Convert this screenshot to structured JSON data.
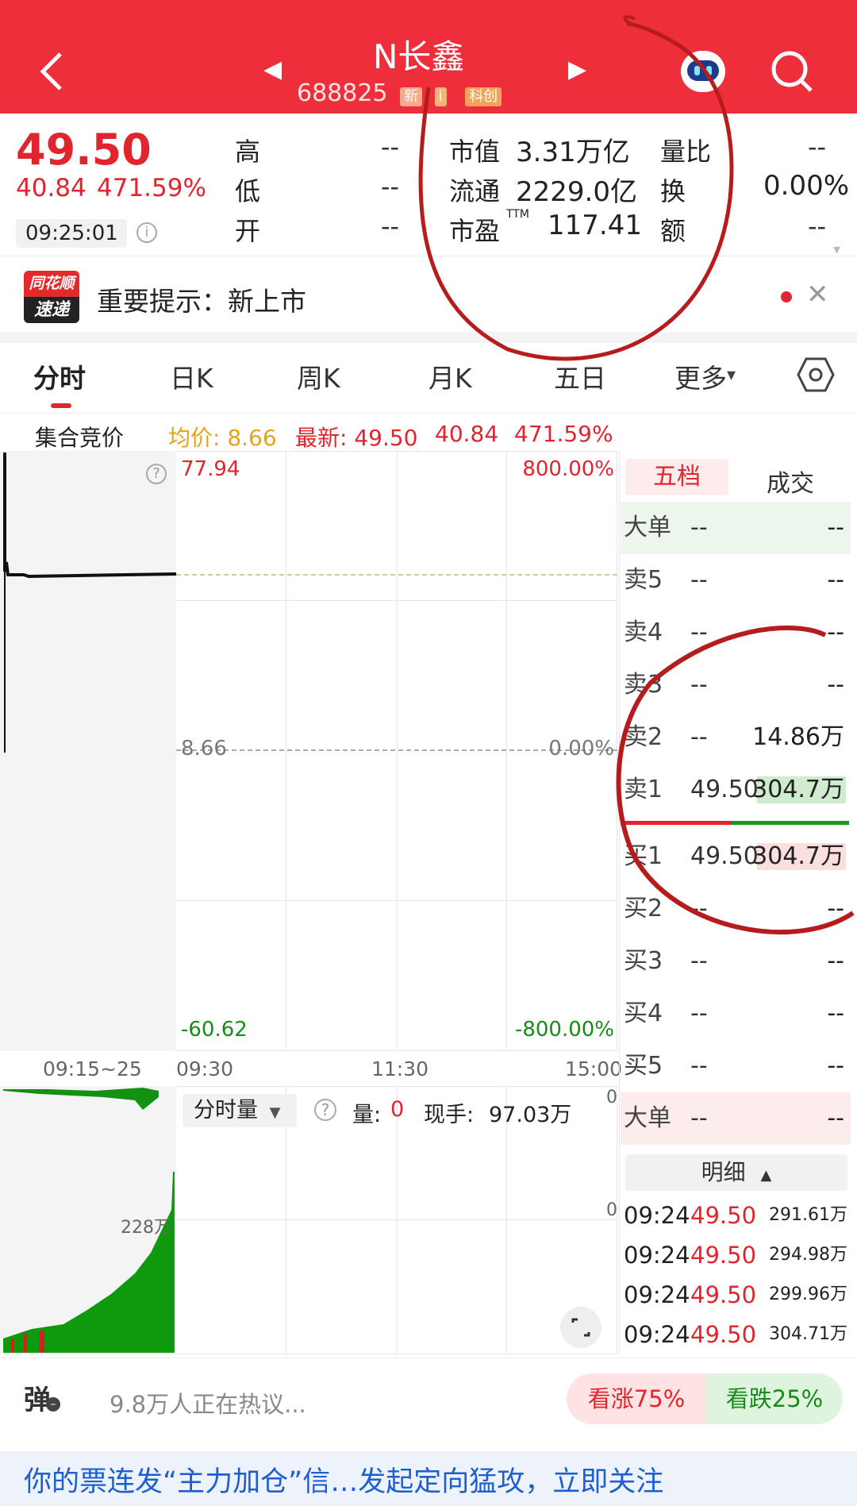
{
  "header": {
    "title": "N长鑫",
    "code": "688825",
    "tags": [
      "新",
      "i",
      "科创"
    ],
    "colors": {
      "bar": "#ee2f3b"
    }
  },
  "quote": {
    "price": "49.50",
    "change": "40.84",
    "change_pct": "471.59%",
    "time": "09:25:01",
    "stats": [
      {
        "label": "高",
        "value": "--"
      },
      {
        "label": "低",
        "value": "--"
      },
      {
        "label": "开",
        "value": "--"
      },
      {
        "label": "市值",
        "value": "3.31万亿"
      },
      {
        "label": "流通",
        "value": "2229.0亿"
      },
      {
        "label": "市盈",
        "sup": "TTM",
        "value": "117.41"
      },
      {
        "label": "量比",
        "value": "--"
      },
      {
        "label": "换",
        "value": "0.00%"
      },
      {
        "label": "额",
        "value": "--"
      }
    ]
  },
  "notice": {
    "logo_top": "同花顺",
    "logo_bottom": "速递",
    "text": "重要提示：新上市"
  },
  "tabs": [
    "分时",
    "日K",
    "周K",
    "月K",
    "五日",
    "更多"
  ],
  "chart_info": {
    "mode": "集合竞价",
    "avg_label": "均价: 8.66",
    "latest_label": "最新: 49.50",
    "change": "40.84",
    "change_pct": "471.59%"
  },
  "chart_data": {
    "type": "line",
    "price_top": "77.94",
    "price_mid": "8.66",
    "price_bottom": "-60.62",
    "pct_top": "800.00%",
    "pct_mid": "0.00%",
    "pct_bottom": "-800.00%",
    "x_ticks": [
      "09:15~25",
      "09:30",
      "11:30",
      "15:00"
    ],
    "auction_price_level": 49.5
  },
  "volume": {
    "selector": "分时量",
    "vol_label": "量:",
    "vol_value": "0",
    "hand_label": "现手:",
    "hand_value": "97.03万",
    "scale_label": "228万",
    "axis_top": "0",
    "axis_mid": "0"
  },
  "orderbook": {
    "tabs": [
      "五档",
      "成交"
    ],
    "rows": [
      {
        "label": "大单",
        "price": "--",
        "vol": "--"
      },
      {
        "label": "卖5",
        "price": "--",
        "vol": "--"
      },
      {
        "label": "卖4",
        "price": "--",
        "vol": "--"
      },
      {
        "label": "卖3",
        "price": "--",
        "vol": "--"
      },
      {
        "label": "卖2",
        "price": "--",
        "vol": "14.86万"
      },
      {
        "label": "卖1",
        "price": "49.50",
        "vol": "304.7万"
      },
      {
        "label": "买1",
        "price": "49.50",
        "vol": "304.7万"
      },
      {
        "label": "买2",
        "price": "--",
        "vol": "--"
      },
      {
        "label": "买3",
        "price": "--",
        "vol": "--"
      },
      {
        "label": "买4",
        "price": "--",
        "vol": "--"
      },
      {
        "label": "买5",
        "price": "--",
        "vol": "--"
      },
      {
        "label": "大单",
        "price": "--",
        "vol": "--"
      }
    ],
    "detail_header": "明细",
    "details": [
      {
        "time": "09:24",
        "price": "49.50",
        "vol": "291.61万"
      },
      {
        "time": "09:24",
        "price": "49.50",
        "vol": "294.98万"
      },
      {
        "time": "09:24",
        "price": "49.50",
        "vol": "299.96万"
      },
      {
        "time": "09:24",
        "price": "49.50",
        "vol": "304.71万"
      }
    ]
  },
  "bottom": {
    "danmu": "弹",
    "discussion": "9.8万人正在热议...",
    "bull": "看涨75%",
    "bear": "看跌25%",
    "banner": "你的票连发“主力加仓”信…发起定向猛攻，立即关注"
  }
}
